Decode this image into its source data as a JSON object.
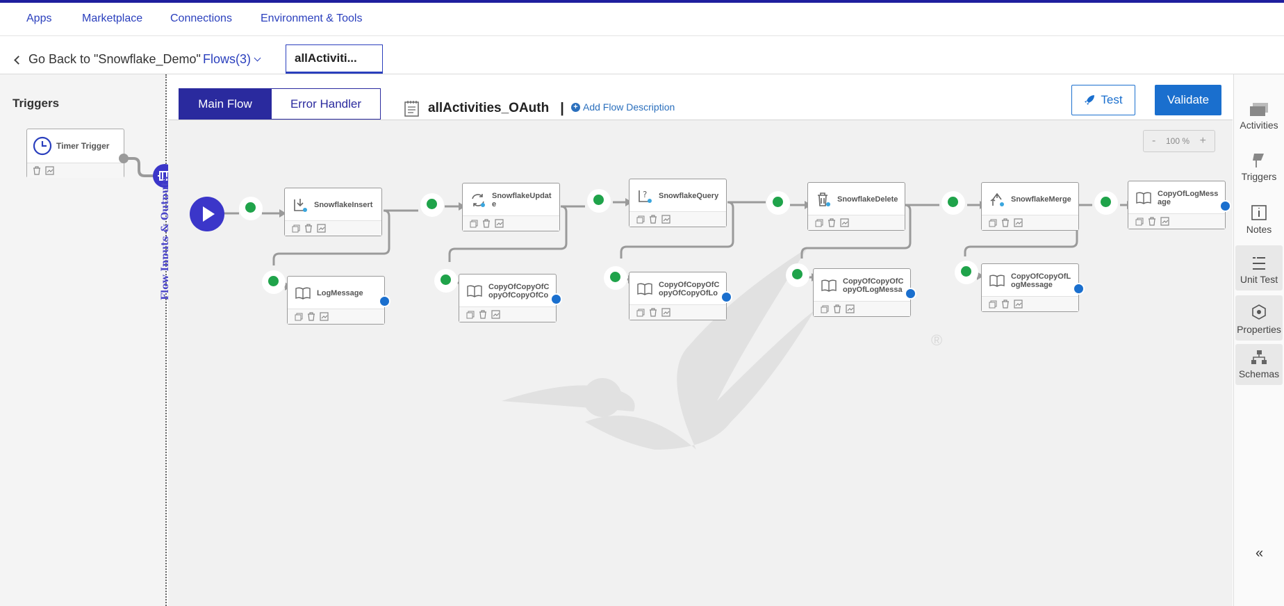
{
  "topnav": {
    "items": [
      "Apps",
      "Marketplace",
      "Connections",
      "Environment & Tools"
    ]
  },
  "subnav": {
    "back_label": "Go Back to \"Snowflake_Demo\"",
    "flows_label": "Flows(3)",
    "active_tab": "allActiviti..."
  },
  "left": {
    "triggers_title": "Triggers",
    "trigger_label": "Timer Trigger",
    "flow_io_label": "Flow Inputs & Outputs"
  },
  "header": {
    "main_flow": "Main Flow",
    "error_handler": "Error Handler",
    "flow_name": "allActivities_OAuth",
    "pipe": "|",
    "add_description": "Add Flow Description",
    "test": "Test",
    "validate": "Validate",
    "zoom_minus": "-",
    "zoom_value": "100 %",
    "zoom_plus": "+"
  },
  "nodes": {
    "n1": "SnowflakeInsert",
    "n2": "SnowflakeUpdate",
    "n3": "SnowflakeQuery",
    "n4": "SnowflakeDelete",
    "n5": "SnowflakeMerge",
    "n6": "CopyOfLogMessage",
    "b1": "LogMessage",
    "b2": "CopyOfCopyOfCopyOfCopyOfCo",
    "b3": "CopyOfCopyOfCopyOfCopyOfLo",
    "b4": "CopyOfCopyOfCopyOfLogMessa",
    "b5": "CopyOfCopyOfLogMessage"
  },
  "rail": {
    "activities": "Activities",
    "triggers": "Triggers",
    "notes": "Notes",
    "unit_test": "Unit Test",
    "properties": "Properties",
    "schemas": "Schemas",
    "collapse": "«"
  },
  "watermark": "®",
  "colors": {
    "brand": "#2a2a9e",
    "accent_blue": "#1a6fce",
    "success": "#1fa34a",
    "link": "#2a3fbd"
  }
}
